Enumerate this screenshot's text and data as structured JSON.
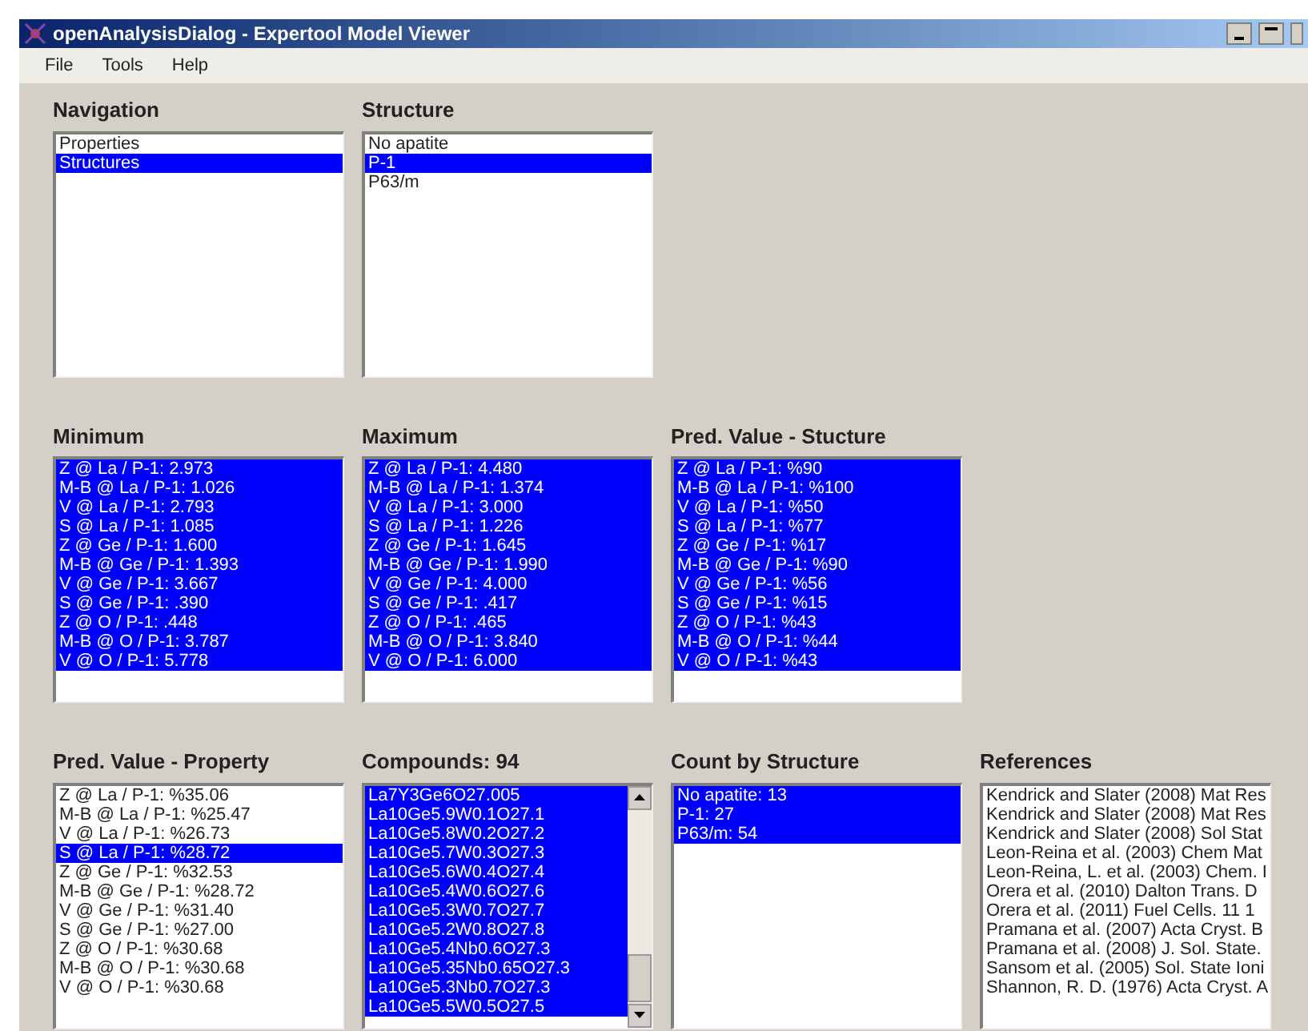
{
  "window": {
    "title": "openAnalysisDialog - Expertool Model Viewer"
  },
  "menu": [
    "File",
    "Tools",
    "Help"
  ],
  "rows": [
    [
      {
        "title": "Navigation",
        "kind": "plain",
        "items": [
          {
            "text": "Properties",
            "selected": false
          },
          {
            "text": "Structures",
            "selected": true
          }
        ]
      },
      {
        "title": "Structure",
        "kind": "plain",
        "items": [
          {
            "text": "No apatite",
            "selected": false
          },
          {
            "text": "P-1",
            "selected": true
          },
          {
            "text": "P63/m",
            "selected": false
          }
        ]
      }
    ],
    [
      {
        "title": "Minimum",
        "kind": "plain",
        "items": [
          {
            "text": "Z @ La / P-1: 2.973",
            "selected": true
          },
          {
            "text": "M-B @ La / P-1: 1.026",
            "selected": true
          },
          {
            "text": "V @ La / P-1: 2.793",
            "selected": true
          },
          {
            "text": "S @ La / P-1: 1.085",
            "selected": true
          },
          {
            "text": "Z @ Ge / P-1: 1.600",
            "selected": true
          },
          {
            "text": "M-B @ Ge / P-1: 1.393",
            "selected": true
          },
          {
            "text": "V @ Ge / P-1: 3.667",
            "selected": true
          },
          {
            "text": "S @ Ge / P-1: .390",
            "selected": true
          },
          {
            "text": "Z @ O / P-1: .448",
            "selected": true
          },
          {
            "text": "M-B @ O / P-1: 3.787",
            "selected": true
          },
          {
            "text": "V @ O / P-1: 5.778",
            "selected": true
          }
        ]
      },
      {
        "title": "Maximum",
        "kind": "plain",
        "items": [
          {
            "text": "Z @ La / P-1: 4.480",
            "selected": true
          },
          {
            "text": "M-B @ La / P-1: 1.374",
            "selected": true
          },
          {
            "text": "V @ La / P-1: 3.000",
            "selected": true
          },
          {
            "text": "S @ La / P-1: 1.226",
            "selected": true
          },
          {
            "text": "Z @ Ge / P-1: 1.645",
            "selected": true
          },
          {
            "text": "M-B @ Ge / P-1: 1.990",
            "selected": true
          },
          {
            "text": "V @ Ge / P-1: 4.000",
            "selected": true
          },
          {
            "text": "S @ Ge / P-1: .417",
            "selected": true
          },
          {
            "text": "Z @ O / P-1: .465",
            "selected": true
          },
          {
            "text": "M-B @ O / P-1: 3.840",
            "selected": true
          },
          {
            "text": "V @ O / P-1: 6.000",
            "selected": true
          }
        ]
      },
      {
        "title": "Pred. Value - Stucture",
        "kind": "plain",
        "items": [
          {
            "text": "Z @ La / P-1: %90",
            "selected": true
          },
          {
            "text": "M-B @ La / P-1: %100",
            "selected": true
          },
          {
            "text": "V @ La / P-1: %50",
            "selected": true
          },
          {
            "text": "S @ La / P-1: %77",
            "selected": true
          },
          {
            "text": "Z @ Ge / P-1: %17",
            "selected": true
          },
          {
            "text": "M-B @ Ge / P-1: %90",
            "selected": true
          },
          {
            "text": "V @ Ge / P-1: %56",
            "selected": true
          },
          {
            "text": "S @ Ge / P-1: %15",
            "selected": true
          },
          {
            "text": "Z @ O / P-1: %43",
            "selected": true
          },
          {
            "text": "M-B @ O / P-1: %44",
            "selected": true
          },
          {
            "text": "V @ O / P-1: %43",
            "selected": true
          }
        ]
      }
    ],
    [
      {
        "title": "Pred. Value - Property",
        "kind": "plain",
        "items": [
          {
            "text": "Z @ La / P-1: %35.06",
            "selected": false
          },
          {
            "text": "M-B @ La / P-1: %25.47",
            "selected": false
          },
          {
            "text": "V @ La / P-1: %26.73",
            "selected": false
          },
          {
            "text": "S @ La / P-1: %28.72",
            "selected": true
          },
          {
            "text": "Z @ Ge / P-1: %32.53",
            "selected": false
          },
          {
            "text": "M-B @ Ge / P-1: %28.72",
            "selected": false
          },
          {
            "text": "V @ Ge / P-1: %31.40",
            "selected": false
          },
          {
            "text": "S @ Ge / P-1: %27.00",
            "selected": false
          },
          {
            "text": "Z @ O / P-1: %30.68",
            "selected": false
          },
          {
            "text": "M-B @ O / P-1: %30.68",
            "selected": false
          },
          {
            "text": "V @ O / P-1: %30.68",
            "selected": false
          }
        ]
      },
      {
        "title": "Compounds: 94",
        "kind": "scrolling",
        "items": [
          {
            "text": "La7Y3Ge6O27.005",
            "selected": true
          },
          {
            "text": "La10Ge5.9W0.1O27.1",
            "selected": true
          },
          {
            "text": "La10Ge5.8W0.2O27.2",
            "selected": true
          },
          {
            "text": "La10Ge5.7W0.3O27.3",
            "selected": true
          },
          {
            "text": "La10Ge5.6W0.4O27.4",
            "selected": true
          },
          {
            "text": "La10Ge5.4W0.6O27.6",
            "selected": true
          },
          {
            "text": "La10Ge5.3W0.7O27.7",
            "selected": true
          },
          {
            "text": "La10Ge5.2W0.8O27.8",
            "selected": true
          },
          {
            "text": "La10Ge5.4Nb0.6O27.3",
            "selected": true
          },
          {
            "text": "La10Ge5.35Nb0.65O27.3",
            "selected": true
          },
          {
            "text": "La10Ge5.3Nb0.7O27.3",
            "selected": true
          },
          {
            "text": "La10Ge5.5W0.5O27.5",
            "selected": true
          }
        ]
      },
      {
        "title": "Count by Structure",
        "kind": "plain",
        "items": [
          {
            "text": "No apatite: 13",
            "selected": true
          },
          {
            "text": "P-1: 27",
            "selected": true
          },
          {
            "text": "P63/m: 54",
            "selected": true
          }
        ]
      },
      {
        "title": "References",
        "kind": "plain",
        "items": [
          {
            "text": "Kendrick and Slater (2008) Mat Res",
            "selected": false
          },
          {
            "text": "Kendrick and Slater (2008) Mat Res",
            "selected": false
          },
          {
            "text": "Kendrick and Slater (2008) Sol Stat",
            "selected": false
          },
          {
            "text": "Leon-Reina et al. (2003) Chem Mat",
            "selected": false
          },
          {
            "text": "Leon-Reina, L. et al. (2003) Chem. I",
            "selected": false
          },
          {
            "text": "Orera et al. (2010) Dalton Trans. D",
            "selected": false
          },
          {
            "text": "Orera et al. (2011) Fuel Cells. 11 1",
            "selected": false
          },
          {
            "text": "Pramana et al. (2007) Acta Cryst. B",
            "selected": false
          },
          {
            "text": "Pramana et al. (2008) J. Sol. State.",
            "selected": false
          },
          {
            "text": "Sansom et al. (2005) Sol. State Ioni",
            "selected": false
          },
          {
            "text": "Shannon, R. D. (1976) Acta Cryst. A",
            "selected": false
          }
        ]
      }
    ]
  ]
}
